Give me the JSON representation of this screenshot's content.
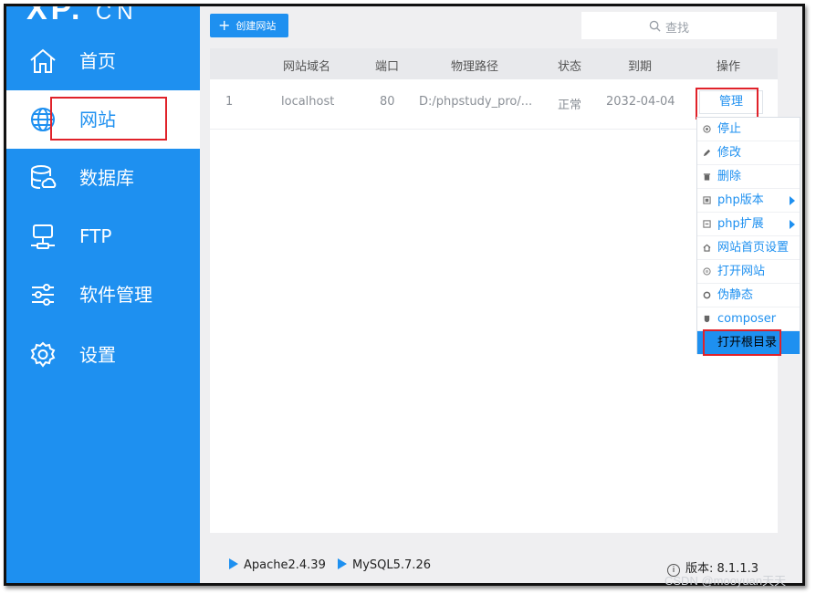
{
  "logo": {
    "main": "XP.",
    "suffix": "CN"
  },
  "sidebar": {
    "items": [
      {
        "label": "首页",
        "icon": "home-icon"
      },
      {
        "label": "网站",
        "icon": "globe-icon",
        "active": true
      },
      {
        "label": "数据库",
        "icon": "database-icon"
      },
      {
        "label": "FTP",
        "icon": "ftp-icon"
      },
      {
        "label": "软件管理",
        "icon": "sliders-icon"
      },
      {
        "label": "设置",
        "icon": "gear-icon"
      }
    ]
  },
  "toolbar": {
    "create_label": "创建网站",
    "search_placeholder": "查找"
  },
  "table": {
    "headers": [
      "网站域名",
      "端口",
      "物理路径",
      "状态",
      "到期",
      "操作"
    ],
    "rows": [
      {
        "index": "1",
        "domain": "localhost",
        "port": "80",
        "path": "D:/phpstudy_pro/...",
        "status": "正常",
        "expire": "2032-04-04",
        "action": "管理"
      }
    ]
  },
  "dropdown": {
    "items": [
      {
        "label": "停止",
        "icon": "stop-icon"
      },
      {
        "label": "修改",
        "icon": "pencil-icon"
      },
      {
        "label": "删除",
        "icon": "trash-icon"
      },
      {
        "label": "php版本",
        "icon": "php-version-icon",
        "submenu": true
      },
      {
        "label": "php扩展",
        "icon": "php-extension-icon",
        "submenu": true
      },
      {
        "label": "网站首页设置",
        "icon": "home-icon"
      },
      {
        "label": "打开网站",
        "icon": "open-site-icon"
      },
      {
        "label": "伪静态",
        "icon": "rewrite-icon"
      },
      {
        "label": "composer",
        "icon": "composer-icon"
      },
      {
        "label": "打开根目录",
        "icon": "folder-icon",
        "highlighted": true
      }
    ]
  },
  "footer": {
    "services": [
      "Apache2.4.39",
      "MySQL5.7.26"
    ],
    "version_label": "版本: 8.1.1.3"
  },
  "watermark": "CSDN @mooyuan天天",
  "colors": {
    "accent": "#1e90f0",
    "annotation": "#e0222a"
  }
}
